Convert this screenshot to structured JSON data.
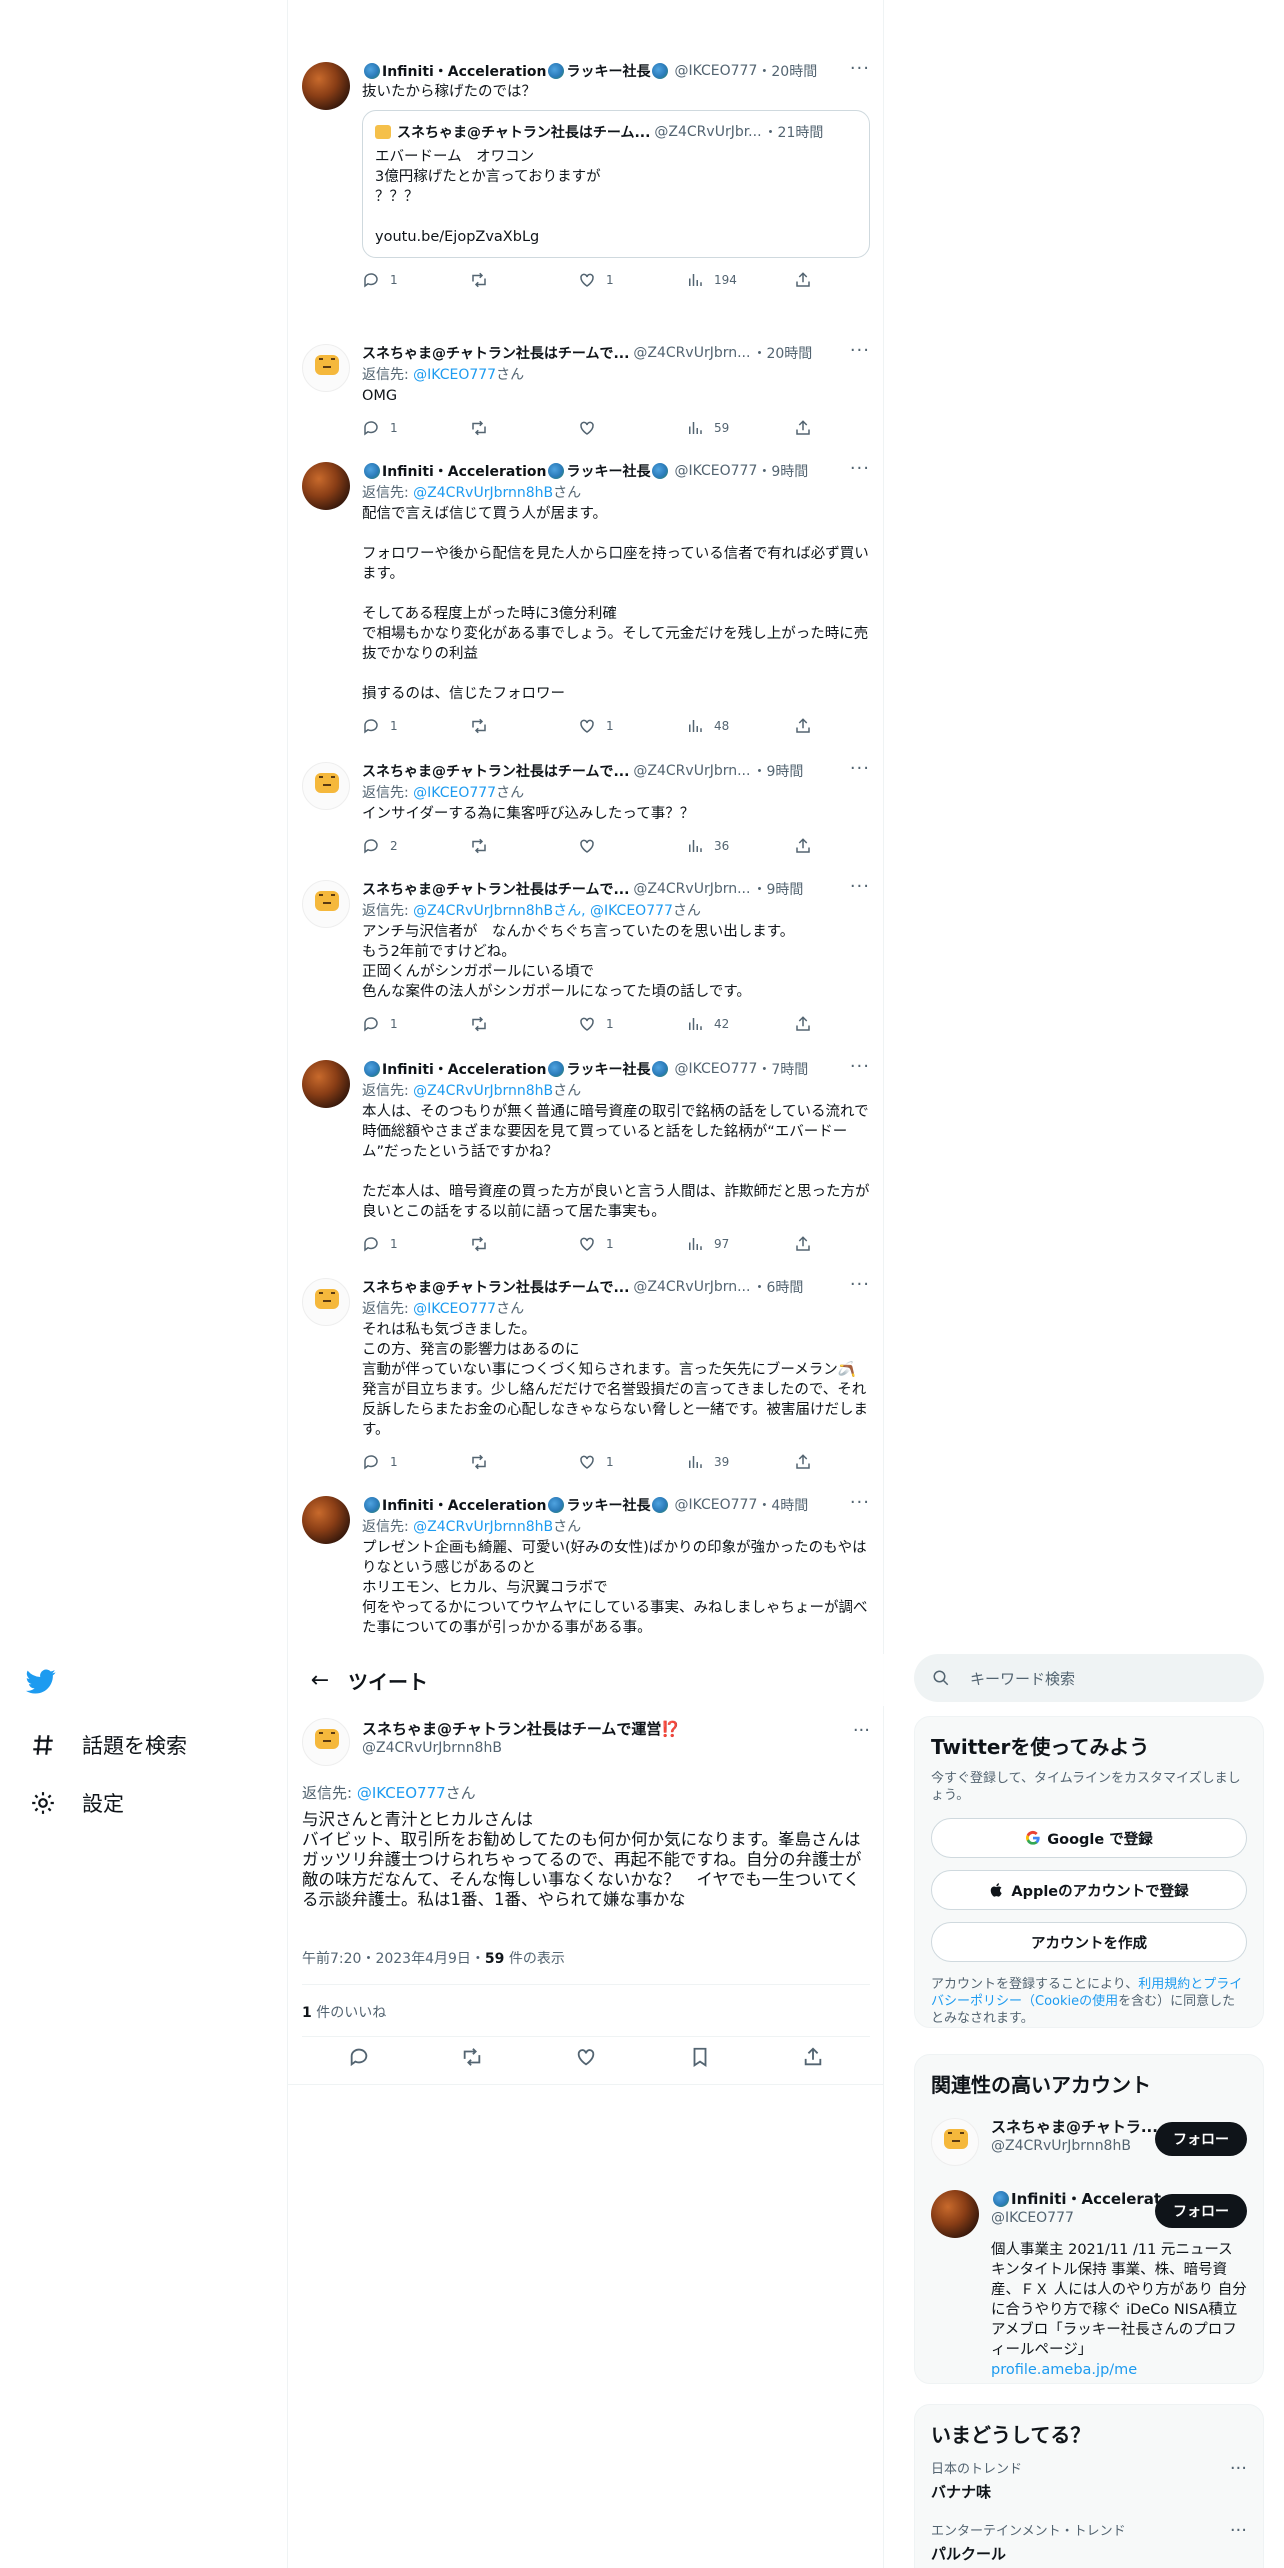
{
  "left_nav": {
    "items": [
      {
        "label": "話題を検索"
      },
      {
        "label": "設定"
      }
    ]
  },
  "timeline": [
    {
      "author": "Infiniti・Acceleration",
      "author_suffix": "ラッキー社長",
      "handle": "@IKCEO777",
      "time": "・20時間",
      "reply_prefix": "",
      "reply_to": "",
      "reply_suffix": "",
      "text": "抜いたから稼げたのでは？",
      "quote": {
        "author": "スネちゃま@チャトラン社長はチーム...",
        "handle": "@Z4CRvUrJbr...",
        "time": "・21時間",
        "text": "エバードーム　オワコン\n3億円稼げたとか言っておりますが\n？？？\n\nyoutu.be/EjopZvaXbLg"
      },
      "replies": "1",
      "retweets": "",
      "likes": "1",
      "views": "194"
    },
    {
      "author": "スネちゃま@チャトラン社長はチームで...",
      "handle": "@Z4CRvUrJbrn...",
      "time": "・20時間",
      "reply_prefix": "返信先: ",
      "reply_to": "@IKCEO777",
      "reply_suffix": "さん",
      "text": "OMG",
      "replies": "1",
      "retweets": "",
      "likes": "",
      "views": "59"
    },
    {
      "author": "Infiniti・Acceleration",
      "author_suffix": "ラッキー社長",
      "handle": "@IKCEO777",
      "time": "・9時間",
      "reply_prefix": "返信先: ",
      "reply_to": "@Z4CRvUrJbrnn8hB",
      "reply_suffix": "さん",
      "text": "配信で言えば信じて買う人が居ます。\n\nフォロワーや後から配信を見た人から口座を持っている信者で有れば必ず買います。\n\nそしてある程度上がった時に3億分利確\nで相場もかなり変化がある事でしょう。そして元金だけを残し上がった時に売抜でかなりの利益\n\n損するのは、信じたフォロワー",
      "replies": "1",
      "retweets": "",
      "likes": "1",
      "views": "48"
    },
    {
      "author": "スネちゃま@チャトラン社長はチームで...",
      "handle": "@Z4CRvUrJbrn...",
      "time": "・9時間",
      "reply_prefix": "返信先: ",
      "reply_to": "@IKCEO777",
      "reply_suffix": "さん",
      "text": "インサイダーする為に集客呼び込みしたって事？？",
      "replies": "2",
      "retweets": "",
      "likes": "",
      "views": "36"
    },
    {
      "author": "スネちゃま@チャトラン社長はチームで...",
      "handle": "@Z4CRvUrJbrn...",
      "time": "・9時間",
      "reply_prefix": "返信先: ",
      "reply_to": "@Z4CRvUrJbrnn8hBさん, @IKCEO777",
      "reply_suffix": "さん",
      "text": "アンチ与沢信者が　なんかぐちぐち言っていたのを思い出します。\nもう2年前ですけどね。\n正岡くんがシンガポールにいる頃で\n色んな案件の法人がシンガポールになってた頃の話しです。",
      "replies": "1",
      "retweets": "",
      "likes": "1",
      "views": "42"
    },
    {
      "author": "Infiniti・Acceleration",
      "author_suffix": "ラッキー社長",
      "handle": "@IKCEO777",
      "time": "・7時間",
      "reply_prefix": "返信先: ",
      "reply_to": "@Z4CRvUrJbrnn8hB",
      "reply_suffix": "さん",
      "text": "本人は、そのつもりが無く普通に暗号資産の取引で銘柄の話をしている流れで時価総額やさまざまな要因を見て買っていると話をした銘柄が“エバードーム”だったという話ですかね？\n\nただ本人は、暗号資産の買った方が良いと言う人間は、詐欺師だと思った方が良いとこの話をする以前に語って居た事実も。",
      "replies": "1",
      "retweets": "",
      "likes": "1",
      "views": "97"
    },
    {
      "author": "スネちゃま@チャトラン社長はチームで...",
      "handle": "@Z4CRvUrJbrn...",
      "time": "・6時間",
      "reply_prefix": "返信先: ",
      "reply_to": "@IKCEO777",
      "reply_suffix": "さん",
      "text": "それは私も気づきました。\nこの方、発言の影響力はあるのに\n言動が伴っていない事につくづく知らされます。言った矢先にブーメラン🪃発言が目立ちます。少し絡んだだけで名誉毀損だの言ってきましたので、それ反訴したらまたお金の心配しなきゃならない脅しと一緒です。被害届けだします。",
      "replies": "1",
      "retweets": "",
      "likes": "1",
      "views": "39"
    },
    {
      "author": "Infiniti・Acceleration",
      "author_suffix": "ラッキー社長",
      "handle": "@IKCEO777",
      "time": "・4時間",
      "reply_prefix": "返信先: ",
      "reply_to": "@Z4CRvUrJbrnn8hB",
      "reply_suffix": "さん",
      "text": "プレゼント企画も綺麗、可愛い(好みの女性)ばかりの印象が強かったのもやはりなという感じがあるのと\nホリエモン、ヒカル、与沢翼コラボで\n何をやってるかについてウヤムヤにしている事実、みねしましゃちょーが調べた事についての事が引っかかる事がある事。\n\n何か有りそうな方に見えます。"
    }
  ],
  "detail": {
    "header_title": "ツイート",
    "author": "スネちゃま@チャトラン社長はチームで運営⁉️",
    "handle": "@Z4CRvUrJbrnn8hB",
    "reply_prefix": "返信先: ",
    "reply_to": "@IKCEO777",
    "reply_suffix": "さん",
    "text": "与沢さんと青汁とヒカルさんは\nバイビット、取引所をお勧めしてたのも何か何か気になります。峯島さんは\nガッツリ弁護士つけられちゃってるので、再起不能ですね。自分の弁護士が敵の味方だなんて、そんな悔しい事なくないかな？　イヤでも一生ついてくる示談弁護士。私は1番、1番、やられて嫌な事かな",
    "time": "午前7:20・2023年4月9日・",
    "views_count": "59",
    "views_label": " 件の表示",
    "likes_count": "1",
    "likes_label": " 件のいいね"
  },
  "search": {
    "placeholder": "キーワード検索"
  },
  "signup": {
    "title": "Twitterを使ってみよう",
    "subtitle": "今すぐ登録して、タイムラインをカスタマイズしましょう。",
    "google": "Google で登録",
    "apple": "Appleのアカウントで登録",
    "create": "アカウントを作成",
    "legal_prefix": "アカウントを登録することにより、",
    "legal_terms": "利用規約とプライバシーポリシー（Cookieの使用",
    "legal_suffix": "を含む）に同意したとみなされます。"
  },
  "related": {
    "title": "関連性の高いアカウント",
    "accounts": [
      {
        "name": "スネちゃま@チャトラ...",
        "handle": "@Z4CRvUrJbrnn8hB",
        "follow": "フォロー",
        "bio": "",
        "link": ""
      },
      {
        "name": "Infiniti・Accelerati...",
        "handle": "@IKCEO777",
        "follow": "フォロー",
        "bio": "個人事業主 2021/11 /11 元ニュースキンタイトル保持 事業、株、暗号資産、ＦＸ 人には人のやり方があり 自分に合うやり方で稼ぐ iDeCo NISA積立 アメブロ「ラッキー社長さんのプロフィールページ」",
        "link": "profile.ameba.jp/me"
      }
    ]
  },
  "trends": {
    "title": "いまどうしてる？",
    "items": [
      {
        "category": "日本のトレンド",
        "name": "バナナ味"
      },
      {
        "category": "エンターテインメント・トレンド",
        "name": "パルクール"
      }
    ]
  },
  "colors": {
    "accent": "#1d9bf0",
    "text": "#0f1419",
    "muted": "#536471",
    "border": "#eff3f4"
  }
}
